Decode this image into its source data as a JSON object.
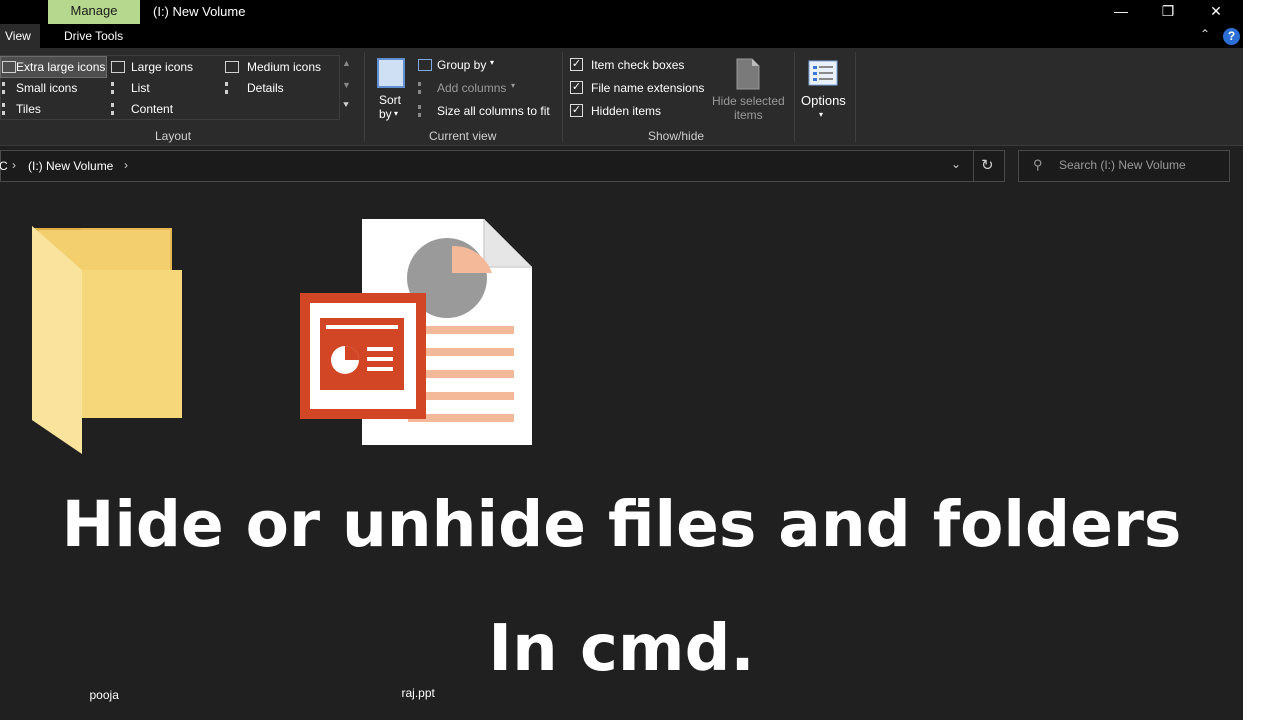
{
  "window": {
    "manage_tab": "Manage",
    "title": "(I:) New Volume",
    "minimize_glyph": "—",
    "restore_glyph": "❐",
    "close_glyph": "✕"
  },
  "ribbon_tabs": {
    "view": "View",
    "drive_tools": "Drive Tools"
  },
  "ribbon": {
    "layout": {
      "extra_large_icons": "Extra large icons",
      "large_icons": "Large icons",
      "medium_icons": "Medium icons",
      "small_icons": "Small icons",
      "list": "List",
      "details": "Details",
      "tiles": "Tiles",
      "content": "Content",
      "group_label": "Layout"
    },
    "current_view": {
      "sort_line1": "Sort",
      "sort_line2": "by",
      "group_by": "Group by",
      "add_columns": "Add columns",
      "size_all_columns": "Size all columns to fit",
      "group_label": "Current view"
    },
    "show_hide": {
      "item_check_boxes": "Item check boxes",
      "file_name_extensions": "File name extensions",
      "hidden_items": "Hidden items",
      "hide_selected_line1": "Hide selected",
      "hide_selected_line2": "items",
      "group_label": "Show/hide"
    },
    "options": "Options"
  },
  "address": {
    "crumb_root": "C",
    "crumb_volume": "(I:) New Volume"
  },
  "search": {
    "placeholder": "Search (I:) New Volume"
  },
  "files": [
    {
      "name": "pooja",
      "type": "folder"
    },
    {
      "name": "raj.ppt",
      "type": "powerpoint"
    }
  ],
  "headline": {
    "line1": "Hide or unhide files and folders",
    "line2": "In cmd."
  },
  "colors": {
    "accent_manage": "#b6d88e",
    "folder": "#f6d77a",
    "ppt_red": "#d24625",
    "ppt_peach": "#f4b999",
    "help": "#2b6fd6"
  }
}
